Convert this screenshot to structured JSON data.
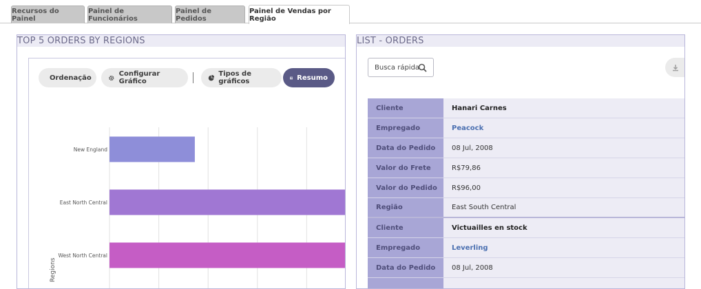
{
  "tabs": [
    {
      "label": "Recursos do Painel"
    },
    {
      "label": "Painel de Funcionários"
    },
    {
      "label": "Painel de Pedidos"
    },
    {
      "label": "Painel de Vendas por Região"
    }
  ],
  "left_panel": {
    "title": "TOP 5 ORDERS BY REGIONS",
    "toolbar": {
      "sort": "Ordenação",
      "configure": "Configurar Gráfico",
      "chart_types": "Tipos de gráficos",
      "summary": "Resumo"
    }
  },
  "chart_data": {
    "type": "bar",
    "orientation": "horizontal",
    "ylabel": "Regions",
    "categories": [
      "New England",
      "East North Central",
      "West North Central"
    ],
    "values": [
      1.65,
      4.7,
      5.0
    ],
    "xlim": [
      0,
      4.7
    ],
    "bar_colors": [
      "#8e8ed9",
      "#a077d3",
      "#c55dc5"
    ],
    "grid": true
  },
  "right_panel": {
    "title": "LIST - ORDERS",
    "search_placeholder": "Busca rápida",
    "records": [
      {
        "fields": [
          {
            "label": "Cliente",
            "value": "Hanari Carnes",
            "style": "bold"
          },
          {
            "label": "Empregado",
            "value": "Peacock",
            "style": "link"
          },
          {
            "label": "Data do Pedido",
            "value": "08 Jul, 2008",
            "style": "plain"
          },
          {
            "label": "Valor do Frete",
            "value": "R$79,86",
            "style": "plain"
          },
          {
            "label": "Valor do Pedido",
            "value": "R$96,00",
            "style": "plain"
          },
          {
            "label": "Região",
            "value": "East South Central",
            "style": "plain"
          }
        ]
      },
      {
        "fields": [
          {
            "label": "Cliente",
            "value": "Victuailles en stock",
            "style": "bold"
          },
          {
            "label": "Empregado",
            "value": "Leverling",
            "style": "link"
          },
          {
            "label": "Data do Pedido",
            "value": "08 Jul, 2008",
            "style": "plain"
          },
          {
            "label": "",
            "value": "",
            "style": "plain"
          }
        ]
      }
    ]
  },
  "colors": {
    "accent": "#5a5a86",
    "label_bg": "#a8a6d6",
    "value_bg": "#edecf5",
    "link": "#4a6fb0"
  }
}
